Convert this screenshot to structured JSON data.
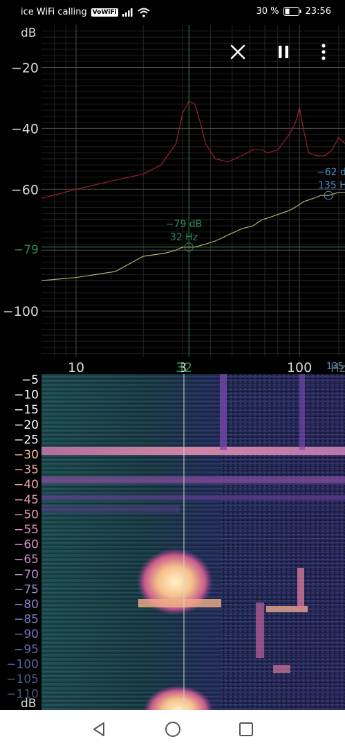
{
  "status": {
    "carrier": "ice WiFi calling",
    "volte": "VoWiFi",
    "battery": "30 %",
    "time": "23:56"
  },
  "graph": {
    "unit": "dB",
    "y_ticks": [
      "−20",
      "−40",
      "−60",
      "−100"
    ],
    "y_tick_values": [
      -20,
      -40,
      -60,
      -100
    ],
    "x_ticks": [
      "10",
      "3",
      "100"
    ],
    "x_tick_values": [
      10,
      30,
      100
    ],
    "cursor_x_label": "32",
    "cursor_y_label": "−79",
    "marker1": {
      "db": "−79 dB",
      "hz": "32 Hz"
    },
    "marker2": {
      "db": "−62 d",
      "hz": "135 H",
      "axis": "135"
    },
    "x_unit": "Hz"
  },
  "chart_data": {
    "type": "line",
    "xlabel": "",
    "ylabel": "dB",
    "xscale": "log",
    "xlim": [
      7,
      160
    ],
    "ylim": [
      -115,
      -6
    ],
    "series": [
      {
        "x": [
          7,
          10,
          15,
          20,
          25,
          28,
          30,
          32,
          34,
          38,
          42,
          48,
          55,
          62,
          68,
          75,
          82,
          90,
          95,
          100,
          105,
          115,
          125,
          135,
          150,
          160
        ],
        "values": [
          -90,
          -89,
          -87,
          -82,
          -81,
          -80,
          -79,
          -79,
          -79,
          -78,
          -77,
          -75,
          -73,
          -72,
          -70,
          -69,
          -68,
          -67,
          -66,
          -65,
          -64,
          -63,
          -62,
          -62,
          -61,
          -61
        ]
      },
      {
        "x": [
          7,
          10,
          15,
          20,
          24,
          28,
          30,
          32,
          34,
          36,
          38,
          42,
          48,
          55,
          62,
          68,
          72,
          80,
          88,
          95,
          98,
          100,
          104,
          110,
          120,
          130,
          140,
          150,
          160
        ],
        "values": [
          -63,
          -60,
          -57,
          -55,
          -52,
          -45,
          -35,
          -31,
          -32,
          -38,
          -45,
          -50,
          -51,
          -49,
          -47,
          -47,
          -48,
          -47,
          -43,
          -39,
          -36,
          -33,
          -40,
          -48,
          -49,
          -49,
          -47,
          -43,
          -45
        ]
      }
    ],
    "markers": [
      {
        "x": 32,
        "y": -79
      },
      {
        "x": 135,
        "y": -62
      }
    ],
    "cursor": {
      "x": 32,
      "y": -79
    }
  },
  "spectrogram": {
    "unit": "dB",
    "labels": [
      "−5",
      "−10",
      "−15",
      "−20",
      "−25",
      "−30",
      "−35",
      "−40",
      "−45",
      "−50",
      "−55",
      "−60",
      "−65",
      "−70",
      "−75",
      "−80",
      "−85",
      "−90",
      "−95",
      "−100",
      "−105",
      "−110"
    ],
    "label_colors": [
      "#ffffff",
      "#ffffff",
      "#ffffff",
      "#ffffff",
      "#ffffff",
      "#f5b8a0",
      "#f0a8a8",
      "#eda3ad",
      "#e89fb3",
      "#e098b8",
      "#d996c4",
      "#d294c8",
      "#c692cd",
      "#b690d0",
      "#a48ad2",
      "#8e84cf",
      "#7a7ec8",
      "#6a76be",
      "#5f6eb0",
      "#55649e",
      "#4d5a8c",
      "#454f7a"
    ]
  },
  "colors": {
    "grid": "#3a3a3a",
    "trace_current": "#b8b070",
    "trace_peak": "#a02030",
    "cursor": "#2e8b57",
    "marker2": "#4a90c8"
  }
}
